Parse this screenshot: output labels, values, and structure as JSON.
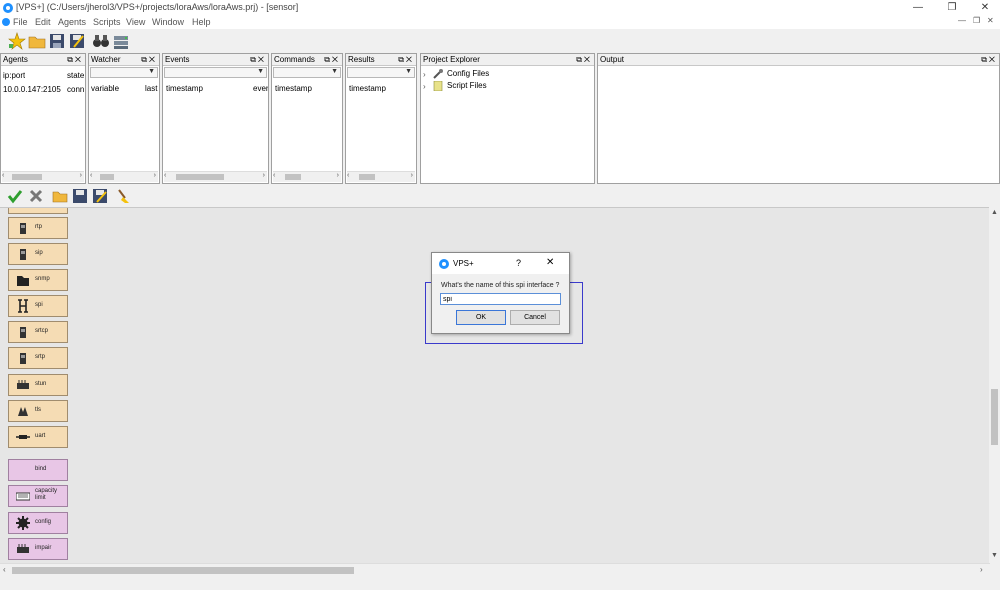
{
  "window": {
    "title": "[VPS+] (C:/Users/jherol3/VPS+/projects/loraAws/loraAws.prj) - [sensor]"
  },
  "menu": [
    "File",
    "Edit",
    "Agents",
    "Scripts",
    "View",
    "Window",
    "Help"
  ],
  "panes": {
    "agents": {
      "title": "Agents",
      "columns": [
        "ip:port",
        "state"
      ],
      "rows": [
        [
          "10.0.0.147:2105",
          "conn"
        ]
      ]
    },
    "watcher": {
      "title": "Watcher",
      "columns": [
        "variable",
        "last"
      ]
    },
    "events": {
      "title": "Events",
      "columns": [
        "timestamp",
        "ever"
      ]
    },
    "commands": {
      "title": "Commands",
      "columns": [
        "timestamp"
      ]
    },
    "results": {
      "title": "Results",
      "columns": [
        "timestamp"
      ]
    },
    "project": {
      "title": "Project Explorer",
      "items": [
        "Config Files",
        "Script Files"
      ]
    },
    "output": {
      "title": "Output"
    }
  },
  "palette": [
    {
      "label": "rtp",
      "icon": "phone-icon",
      "color": "tan"
    },
    {
      "label": "sip",
      "icon": "phone-icon",
      "color": "tan"
    },
    {
      "label": "snmp",
      "icon": "folder-icon",
      "color": "tan"
    },
    {
      "label": "spi",
      "icon": "spi-icon",
      "color": "tan"
    },
    {
      "label": "srtcp",
      "icon": "phone-icon",
      "color": "tan"
    },
    {
      "label": "srtp",
      "icon": "phone-icon",
      "color": "tan"
    },
    {
      "label": "stun",
      "icon": "device-icon",
      "color": "tan"
    },
    {
      "label": "tls",
      "icon": "hands-icon",
      "color": "tan"
    },
    {
      "label": "uart",
      "icon": "cable-icon",
      "color": "tan"
    },
    {
      "label": "bind",
      "icon": "",
      "color": "pink"
    },
    {
      "label": "capacity limit",
      "icon": "keyboard-icon",
      "color": "pink"
    },
    {
      "label": "config",
      "icon": "gear-icon",
      "color": "pink"
    },
    {
      "label": "impair",
      "icon": "device-icon",
      "color": "pink"
    }
  ],
  "dialog": {
    "title": "VPS+",
    "help": "?",
    "close": "✕",
    "prompt": "What's the name of this spi interface ?",
    "value": "spi",
    "ok_label": "OK",
    "cancel_label": "Cancel"
  }
}
